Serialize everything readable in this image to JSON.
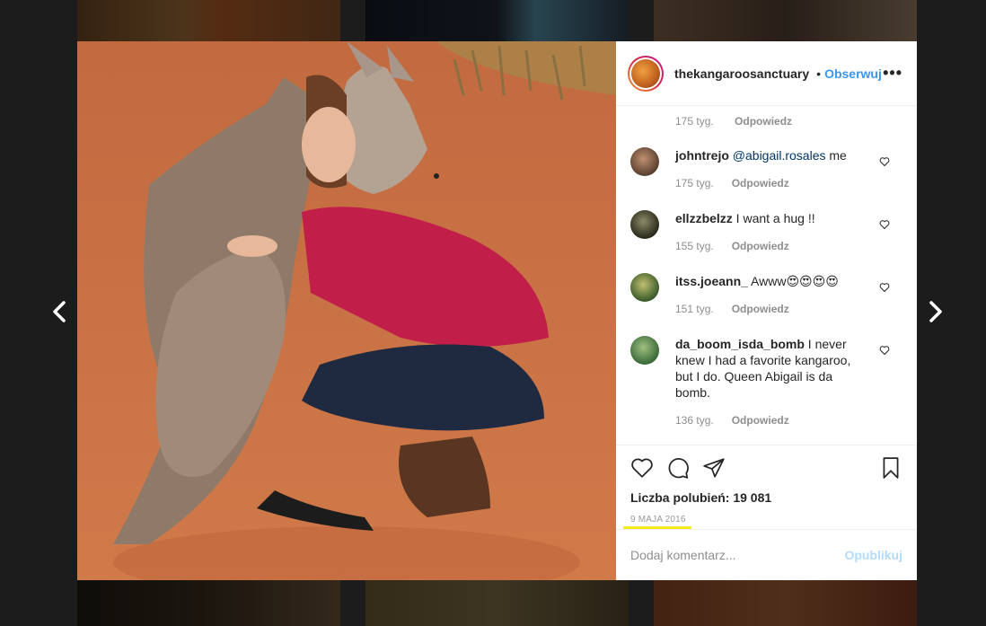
{
  "post": {
    "username": "thekangaroosanctuary",
    "separator": "•",
    "follow_label": "Obserwuj",
    "more_icon": "more-options-icon",
    "photo_alt": "Woman hugging kangaroo"
  },
  "top_meta": {
    "time": "175 tyg.",
    "reply": "Odpowiedz"
  },
  "comments": [
    {
      "user": "johntrejo",
      "mention": "@abigail.rosales",
      "text": " me",
      "time": "175 tyg.",
      "reply": "Odpowiedz",
      "avatar_color": "#5a4030"
    },
    {
      "user": "ellzzbelzz",
      "mention": "",
      "text": " I want a hug !!",
      "time": "155 tyg.",
      "reply": "Odpowiedz",
      "avatar_color": "#3a3a2a"
    },
    {
      "user": "itss.joeann_",
      "mention": "",
      "text": " Awww😍😍😍😍",
      "time": "151 tyg.",
      "reply": "Odpowiedz",
      "avatar_color": "#6a7040"
    },
    {
      "user": "da_boom_isda_bomb",
      "mention": "",
      "text": " I never knew I had a favorite kangaroo, but I do. Queen Abigail is da bomb.",
      "time": "136 tyg.",
      "reply": "Odpowiedz",
      "avatar_color": "#4a6a3a"
    }
  ],
  "actions": {
    "likes_label": "Liczba polubień: 19 081",
    "date": "9 MAJA 2016",
    "highlight_color": "#f2ec1a"
  },
  "add_comment": {
    "placeholder": "Dodaj komentarz...",
    "publish_label": "Opublikuj"
  },
  "colors": {
    "follow": "#3897f0",
    "publish_disabled": "#b3dbff",
    "text": "#262626",
    "meta": "#8e8e8e"
  }
}
